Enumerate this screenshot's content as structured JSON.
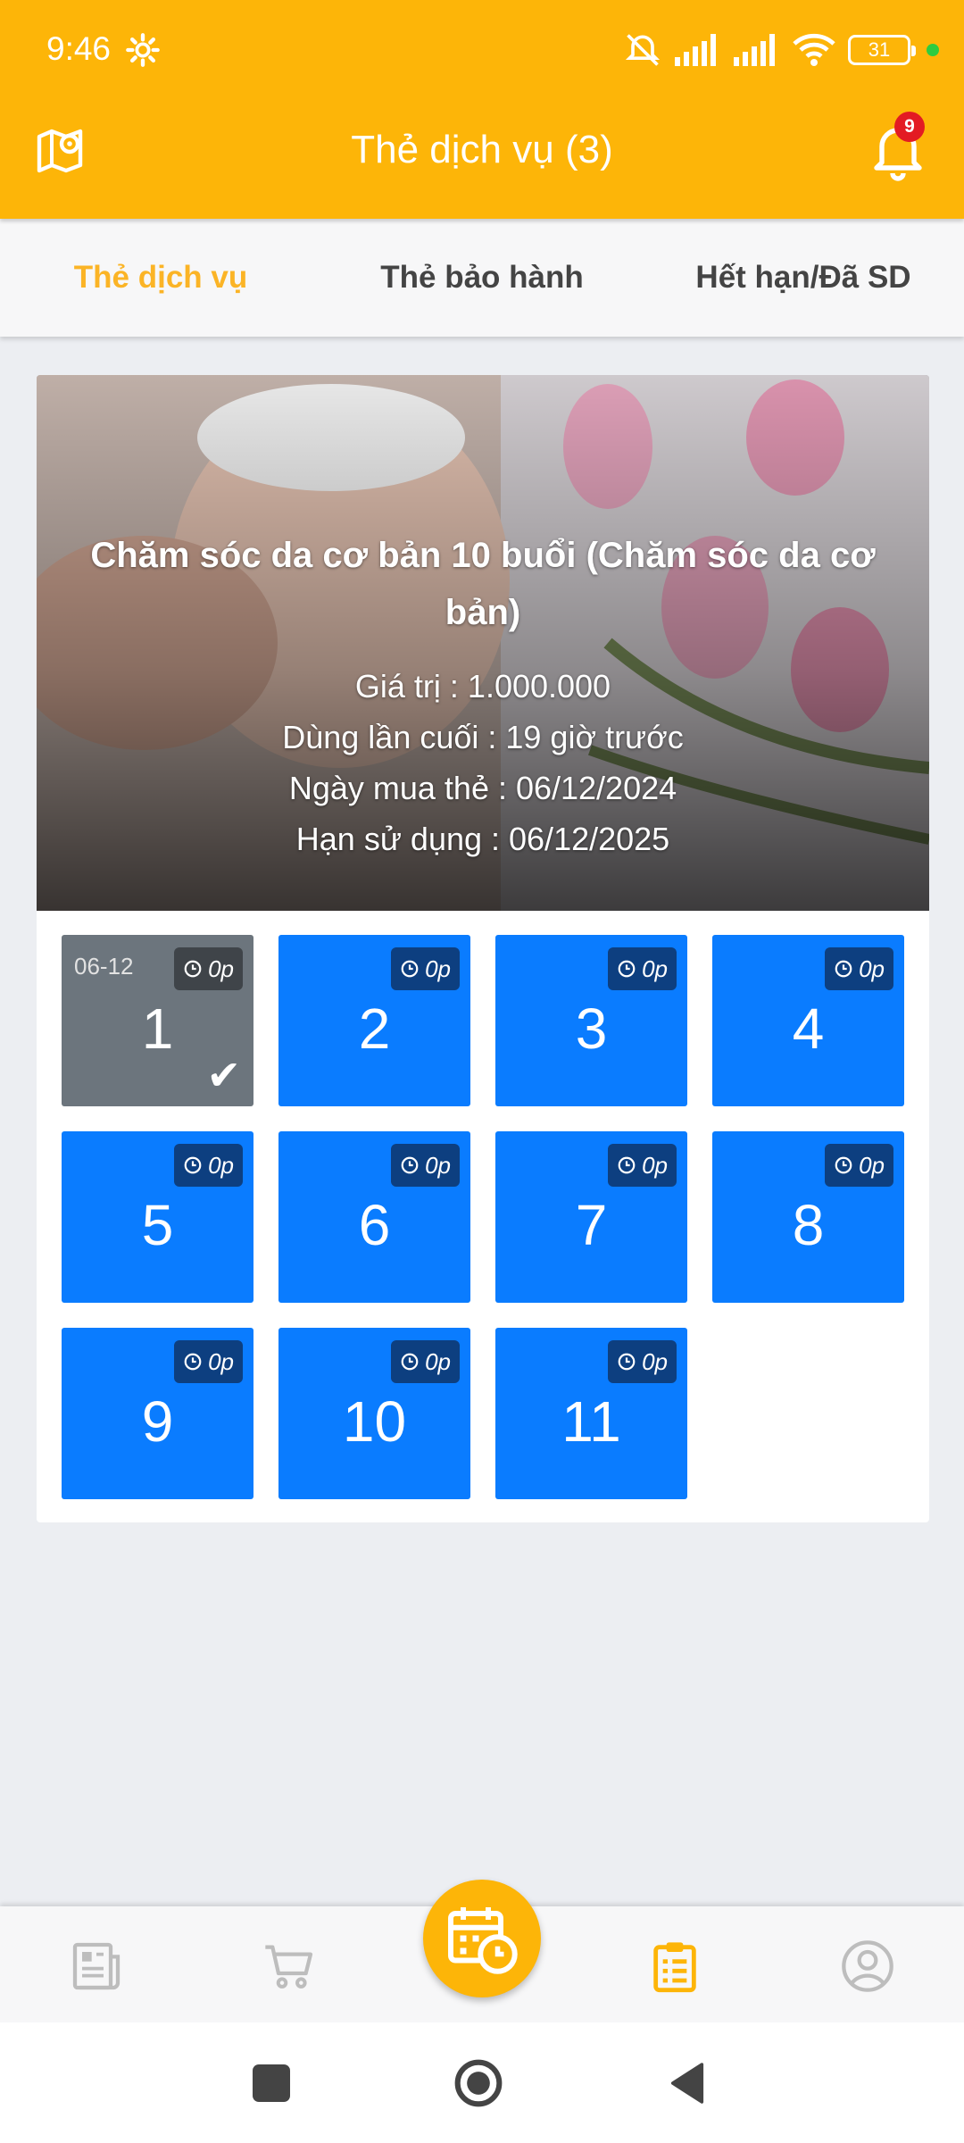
{
  "status_bar": {
    "time": "9:46",
    "battery": "31"
  },
  "app_bar": {
    "title": "Thẻ dịch vụ (3)",
    "notification_count": "9"
  },
  "tabs": [
    {
      "label": "Thẻ dịch vụ",
      "active": true
    },
    {
      "label": "Thẻ bảo hành",
      "active": false
    },
    {
      "label": "Hết hạn/Đã SD",
      "active": false
    }
  ],
  "card": {
    "title": "Chăm sóc da cơ bản 10 buổi (Chăm sóc da cơ bản)",
    "value_line": "Giá trị : 1.000.000",
    "last_used_line": "Dùng lần cuối : 19 giờ trước",
    "purchase_date_line": "Ngày mua thẻ : 06/12/2024",
    "expiry_line": "Hạn sử dụng : 06/12/2025",
    "sessions": [
      {
        "number": "1",
        "time": "0p",
        "used": true,
        "date": "06-12"
      },
      {
        "number": "2",
        "time": "0p",
        "used": false
      },
      {
        "number": "3",
        "time": "0p",
        "used": false
      },
      {
        "number": "4",
        "time": "0p",
        "used": false
      },
      {
        "number": "5",
        "time": "0p",
        "used": false
      },
      {
        "number": "6",
        "time": "0p",
        "used": false
      },
      {
        "number": "7",
        "time": "0p",
        "used": false
      },
      {
        "number": "8",
        "time": "0p",
        "used": false
      },
      {
        "number": "9",
        "time": "0p",
        "used": false
      },
      {
        "number": "10",
        "time": "0p",
        "used": false
      },
      {
        "number": "11",
        "time": "0p",
        "used": false
      }
    ]
  },
  "colors": {
    "brand": "#fdb508",
    "session_active": "#0a7cff",
    "session_used": "#6c757d",
    "tab_active": "#fbb426"
  },
  "bottom_nav": {
    "items": [
      {
        "icon": "news-icon",
        "active": false
      },
      {
        "icon": "cart-icon",
        "active": false
      },
      {
        "icon": "calendar-clock-icon",
        "active": false
      },
      {
        "icon": "clipboard-list-icon",
        "active": true
      },
      {
        "icon": "user-circle-icon",
        "active": false
      }
    ]
  }
}
